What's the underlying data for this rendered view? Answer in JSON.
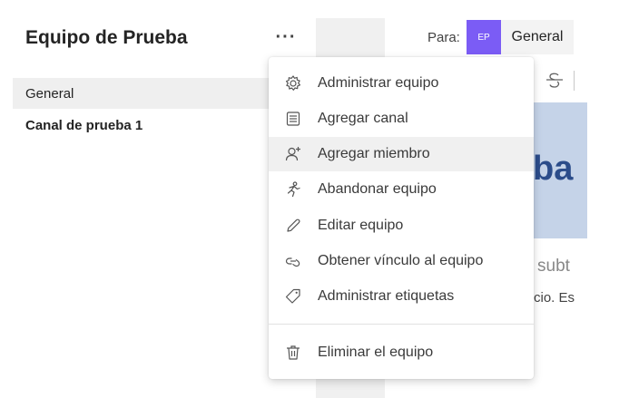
{
  "sidebar": {
    "team_title": "Equipo de Prueba",
    "more_label": "···",
    "channels": [
      {
        "label": "General"
      },
      {
        "label": "Canal de prueba 1"
      }
    ]
  },
  "header": {
    "to_label": "Para:",
    "avatar_initials": "EP",
    "channel_chip": "General"
  },
  "content": {
    "banner_fragment": "ba",
    "subtitle_fragment": "subt",
    "body_fragment": "cio. Es"
  },
  "menu": {
    "items": [
      {
        "label": "Administrar equipo",
        "icon": "gear-icon"
      },
      {
        "label": "Agregar canal",
        "icon": "channel-list-icon"
      },
      {
        "label": "Agregar miembro",
        "icon": "add-person-icon"
      },
      {
        "label": "Abandonar equipo",
        "icon": "leave-person-icon"
      },
      {
        "label": "Editar equipo",
        "icon": "pencil-icon"
      },
      {
        "label": "Obtener vínculo al equipo",
        "icon": "link-icon"
      },
      {
        "label": "Administrar etiquetas",
        "icon": "tag-icon"
      },
      {
        "label": "Eliminar el equipo",
        "icon": "trash-icon"
      }
    ],
    "hovered_item": "Agregar miembro"
  },
  "colors": {
    "avatar": "#7b5cf5",
    "selected_channel_bg": "#efefef",
    "menu_hover_bg": "#f0f0f0"
  }
}
